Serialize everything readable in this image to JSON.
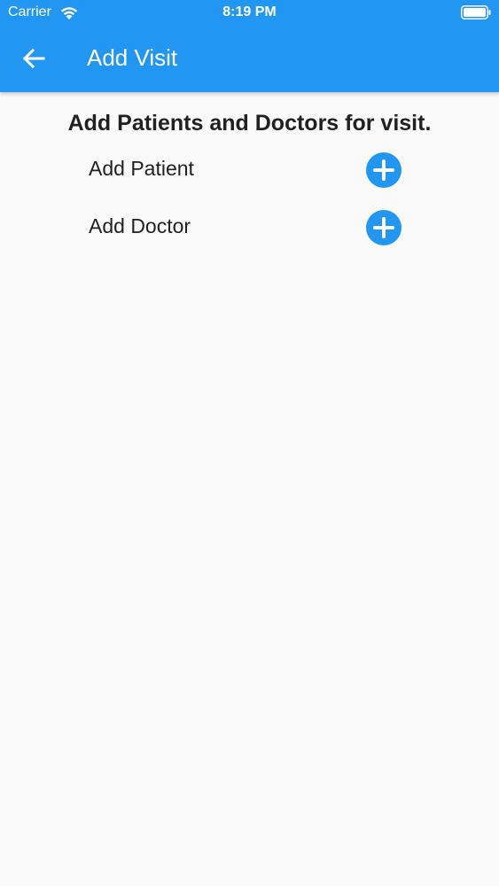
{
  "status_bar": {
    "carrier": "Carrier",
    "time": "8:19 PM",
    "wifi_icon": "wifi-icon",
    "battery_icon": "battery-icon"
  },
  "app_bar": {
    "title": "Add Visit",
    "back_icon": "arrow-left-icon",
    "color": "#2196f3"
  },
  "main": {
    "heading": "Add Patients and Doctors for visit.",
    "rows": [
      {
        "label": "Add Patient",
        "icon": "plus-circle-icon"
      },
      {
        "label": "Add Doctor",
        "icon": "plus-circle-icon"
      }
    ],
    "accent": "#2196f3"
  }
}
